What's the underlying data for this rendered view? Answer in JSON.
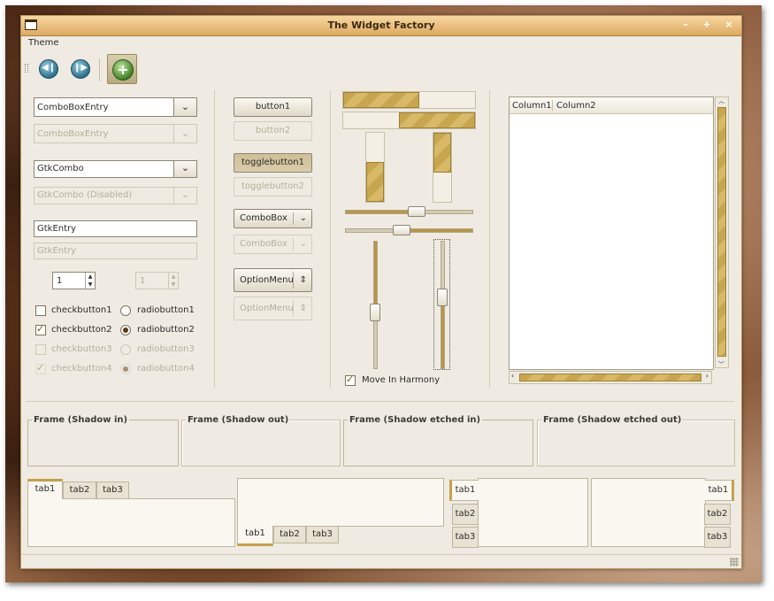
{
  "window": {
    "title": "The Widget Factory"
  },
  "menu": {
    "theme": "Theme"
  },
  "toolbar": {
    "back_icon": "go-back-icon",
    "forward_icon": "go-forward-icon",
    "add_icon": "add-icon"
  },
  "combos": {
    "combo_entry": "ComboBoxEntry",
    "combo_entry_disabled": "ComboBoxEntry",
    "gtk_combo": "GtkCombo",
    "gtk_combo_disabled": "GtkCombo (Disabled)"
  },
  "entries": {
    "entry": "GtkEntry",
    "entry_disabled": "GtkEntry"
  },
  "spins": {
    "spin": "1",
    "spin_disabled": "1"
  },
  "checks": [
    {
      "label": "checkbutton1",
      "checked": false,
      "disabled": false
    },
    {
      "label": "checkbutton2",
      "checked": true,
      "disabled": false
    },
    {
      "label": "checkbutton3",
      "checked": false,
      "disabled": true
    },
    {
      "label": "checkbutton4",
      "checked": true,
      "disabled": true
    }
  ],
  "radios": [
    {
      "label": "radiobutton1",
      "checked": false,
      "disabled": false
    },
    {
      "label": "radiobutton2",
      "checked": true,
      "disabled": false
    },
    {
      "label": "radiobutton3",
      "checked": false,
      "disabled": true
    },
    {
      "label": "radiobutton4",
      "checked": true,
      "disabled": true
    }
  ],
  "buttons": {
    "button1": "button1",
    "button2": "button2",
    "toggle1": "togglebutton1",
    "toggle2": "togglebutton2",
    "combobox": "ComboBox",
    "combobox_disabled": "ComboBox",
    "optionmenu": "OptionMenu",
    "optionmenu_disabled": "OptionMenu"
  },
  "progress": {
    "h1": 0.58,
    "h2": 0.58,
    "v1": 0.58,
    "v2": 0.58
  },
  "sliders": {
    "h1": 0.57,
    "h2": 0.43,
    "v1": 0.57,
    "v2": 0.43
  },
  "harmony": {
    "label": "Move In Harmony",
    "checked": true
  },
  "tree": {
    "columns": [
      "Column1",
      "Column2"
    ]
  },
  "frames": {
    "shadow_in": "Frame (Shadow in)",
    "shadow_out": "Frame (Shadow out)",
    "etched_in": "Frame (Shadow etched in)",
    "etched_out": "Frame (Shadow etched out)"
  },
  "notebooks": {
    "tabs": [
      "tab1",
      "tab2",
      "tab3"
    ]
  },
  "colors": {
    "accent": "#c4a04c",
    "titlebar": "#dda962",
    "background": "#efebe2"
  }
}
